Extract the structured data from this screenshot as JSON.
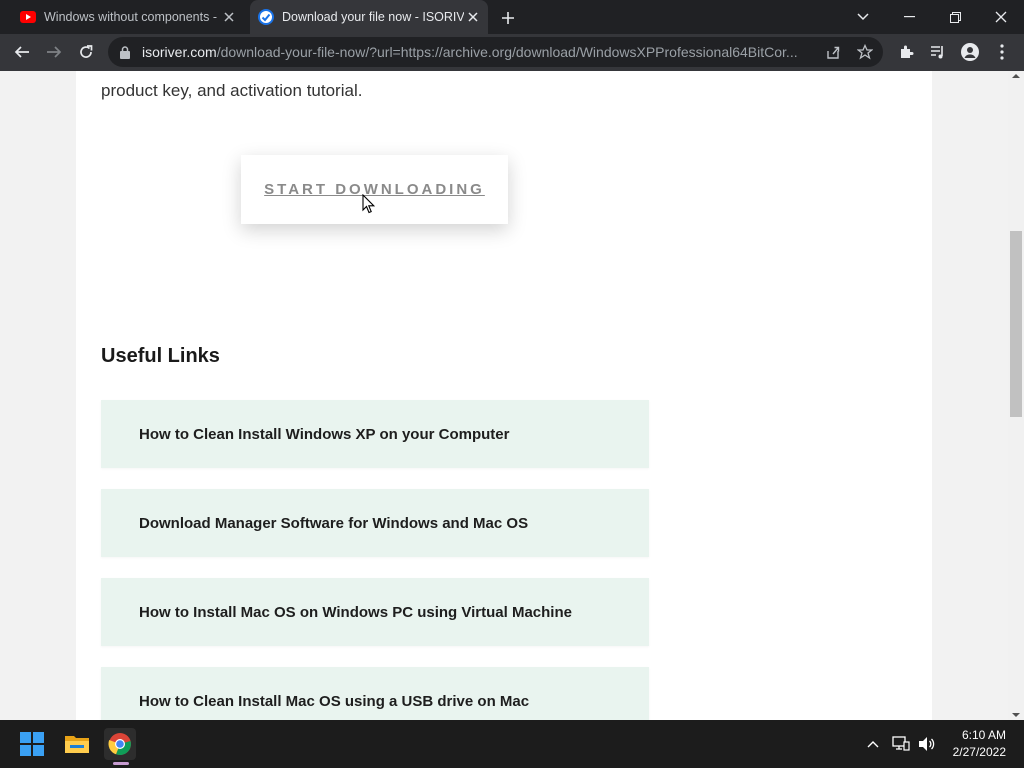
{
  "browser": {
    "tabs": [
      {
        "title": "Windows without components -",
        "favicon": "youtube-icon",
        "active": false
      },
      {
        "title": "Download your file now - ISORIV",
        "favicon": "site-check-icon",
        "active": true
      }
    ],
    "url_host": "isoriver.com",
    "url_path": "/download-your-file-now/?url=https://archive.org/download/WindowsXPProfessional64BitCor..."
  },
  "page": {
    "intro_text": "product key, and activation tutorial.",
    "download_button": "START DOWNLOADING",
    "useful_links_heading": "Useful Links",
    "links": [
      "How to Clean Install Windows XP on your Computer",
      "Download Manager Software for Windows and Mac OS",
      "How to Install Mac OS on Windows PC using Virtual Machine",
      "How to Clean Install Mac OS using a USB drive on Mac"
    ]
  },
  "taskbar": {
    "time": "6:10 AM",
    "date": "2/27/2022"
  },
  "colors": {
    "link_card_bg": "#e9f4ef",
    "chrome_dark": "#202124",
    "toolbar": "#35363a"
  }
}
